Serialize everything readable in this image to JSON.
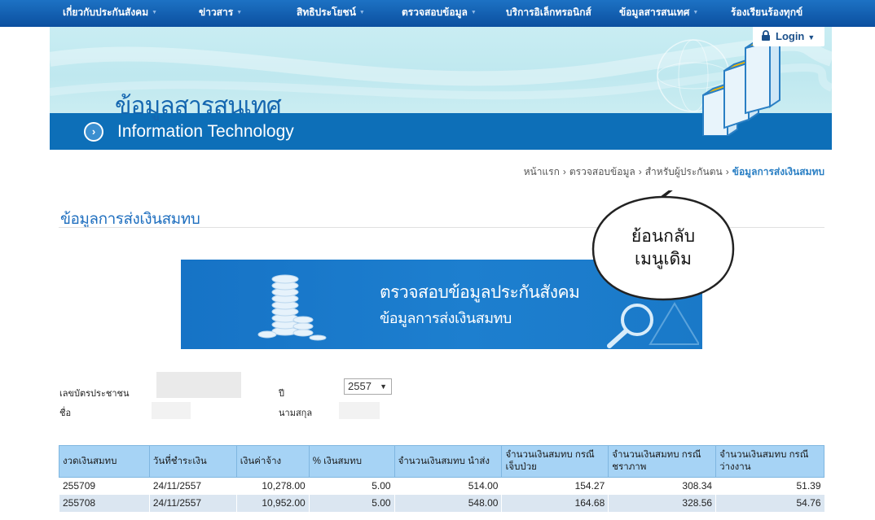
{
  "nav": {
    "items": [
      {
        "label": "เกี่ยวกับประกันสังคม",
        "has_dropdown": true
      },
      {
        "label": "ข่าวสาร",
        "has_dropdown": true
      },
      {
        "label": "สิทธิประโยชน์",
        "has_dropdown": true
      },
      {
        "label": "ตรวจสอบข้อมูล",
        "has_dropdown": true
      },
      {
        "label": "บริการอิเล็กทรอนิกส์",
        "has_dropdown": false
      },
      {
        "label": "ข้อมูลสารสนเทศ",
        "has_dropdown": true
      },
      {
        "label": "ร้องเรียนร้องทุกข์",
        "has_dropdown": false
      }
    ]
  },
  "login": {
    "label": "Login",
    "icon": "lock-icon"
  },
  "banner": {
    "thai_title": "ข้อมูลสารสนเทศ",
    "en_title": "Information Technology",
    "icon": "circle-arrow-right-icon"
  },
  "breadcrumb": {
    "items": [
      "หน้าแรก",
      "ตรวจสอบข้อมูล",
      "สำหรับผู้ประกันตน"
    ],
    "current": "ข้อมูลการส่งเงินสมทบ",
    "separator": "›"
  },
  "page": {
    "title": "ข้อมูลการส่งเงินสมทบ"
  },
  "bubble": {
    "line1": "ย้อนกลับ",
    "line2": "เมนูเดิม"
  },
  "promo": {
    "line1": "ตรวจสอบข้อมูลประกันสังคม",
    "line2": "ข้อมูลการส่งเงินสมทบ"
  },
  "form": {
    "id_label": "เลขบัตรประชาชน",
    "year_label": "ปี",
    "year_value": "2557",
    "name_label": "ชื่อ",
    "surname_label": "นามสกุล"
  },
  "table": {
    "headers": [
      "งวดเงินสมทบ",
      "วันที่ชำระเงิน",
      "เงินค่าจ้าง",
      "% เงินสมทบ",
      "จำนวนเงินสมทบ นำส่ง",
      "จำนวนเงินสมทบ กรณีเจ็บป่วย",
      "จำนวนเงินสมทบ กรณีชราภาพ",
      "จำนวนเงินสมทบ กรณีว่างงาน"
    ],
    "rows": [
      [
        "255709",
        "24/11/2557",
        "10,278.00",
        "5.00",
        "514.00",
        "154.27",
        "308.34",
        "51.39"
      ],
      [
        "255708",
        "24/11/2557",
        "10,952.00",
        "5.00",
        "548.00",
        "164.68",
        "328.56",
        "54.76"
      ]
    ]
  },
  "colors": {
    "nav_bg": "#0b4f9f",
    "banner_bar": "#0d6fb8",
    "accent": "#1f6fbf",
    "table_header": "#a6d3f5",
    "table_alt_row": "#dbe6f1"
  }
}
